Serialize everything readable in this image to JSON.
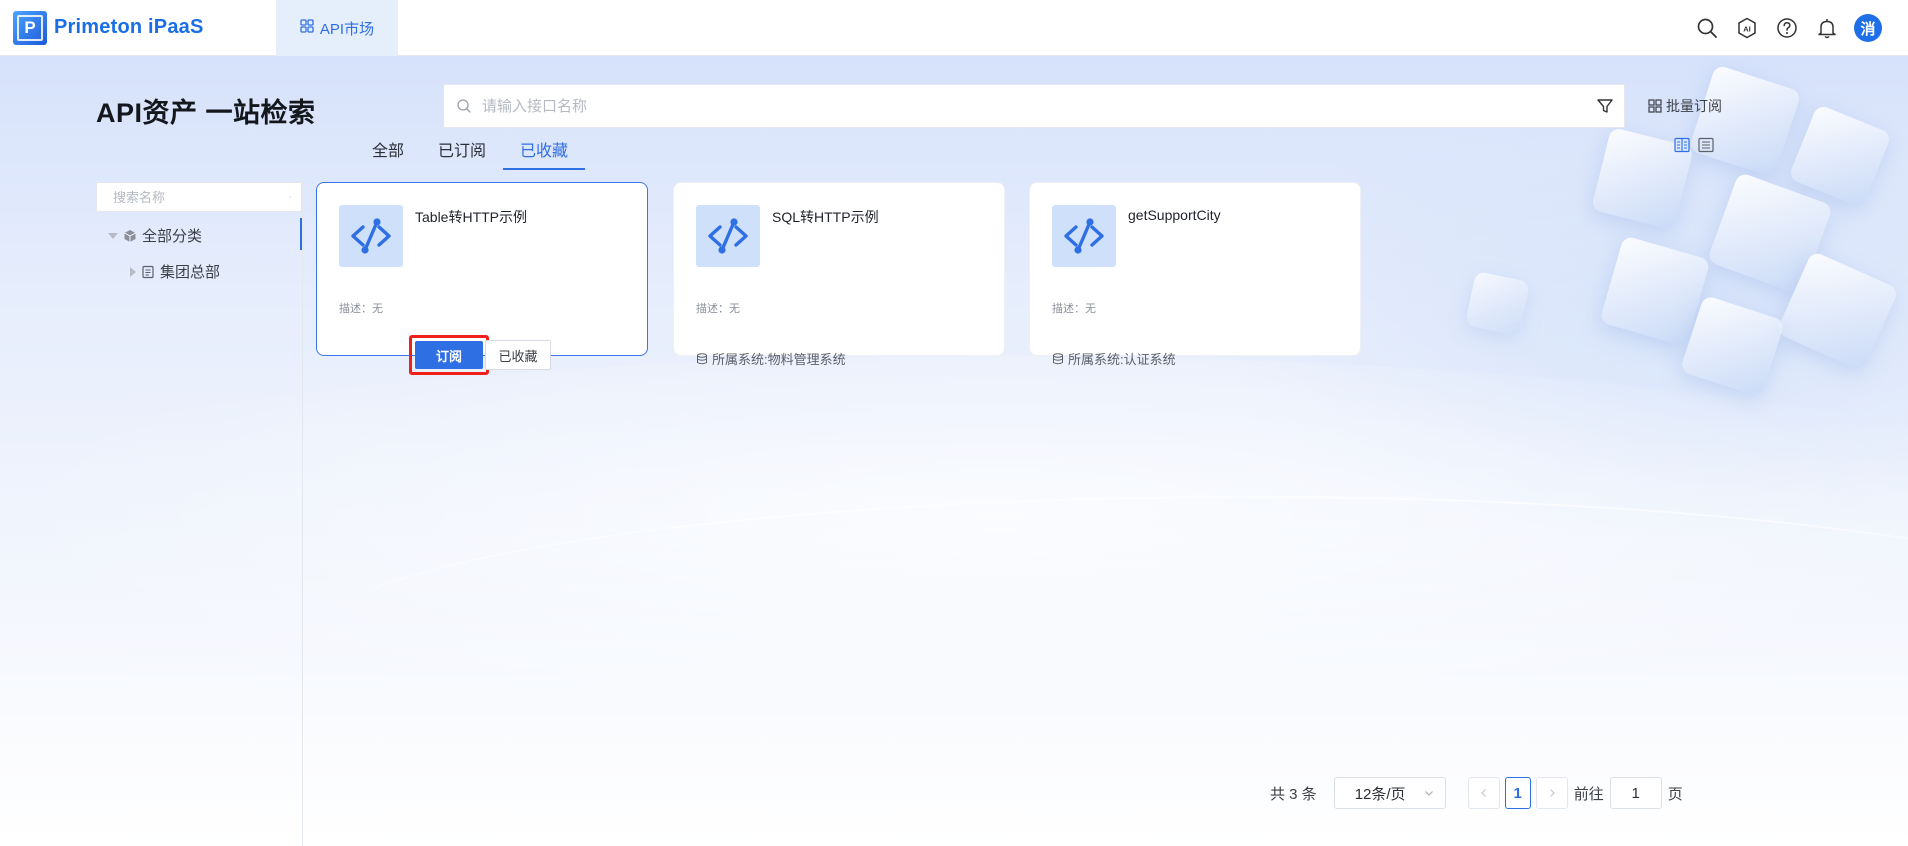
{
  "app": {
    "logo_letter": "P",
    "name": "Primeton iPaaS",
    "nav_tab": "API市场",
    "avatar_text": "消",
    "ai_label": "AI"
  },
  "page": {
    "title": "API资产 一站检索",
    "search_placeholder": "请输入接口名称",
    "batch_subscribe": "批量订阅"
  },
  "tabs": [
    {
      "label": "全部",
      "active": false
    },
    {
      "label": "已订阅",
      "active": false
    },
    {
      "label": "已收藏",
      "active": true
    }
  ],
  "sidebar": {
    "search_placeholder": "搜索名称",
    "tree": [
      {
        "label": "全部分类",
        "level": 0
      },
      {
        "label": "集团总部",
        "level": 1
      }
    ]
  },
  "cards": [
    {
      "title": "Table转HTTP示例",
      "desc": "描述：无",
      "subscribe_label": "订阅",
      "favorite_label": "已收藏"
    },
    {
      "title": "SQL转HTTP示例",
      "desc": "描述：无",
      "system": "所属系统:物料管理系统"
    },
    {
      "title": "getSupportCity",
      "desc": "描述：无",
      "system": "所属系统:认证系统"
    }
  ],
  "pagination": {
    "total": "共 3 条",
    "page_size": "12条/页",
    "current_page": "1",
    "goto_label": "前往",
    "goto_value": "1",
    "page_suffix": "页"
  },
  "colors": {
    "primary": "#2f6fe4",
    "highlight": "#f0201b"
  }
}
